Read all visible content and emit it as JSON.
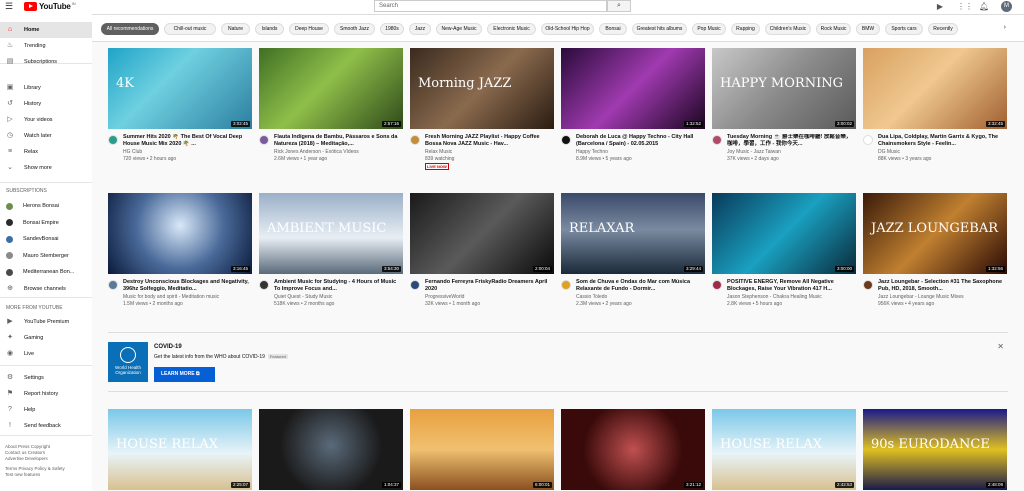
{
  "topbar": {
    "logo_text": "YouTube",
    "logo_sup": "IN",
    "search_placeholder": "Search",
    "avatar_letter": "M"
  },
  "sidebar": {
    "main": [
      {
        "label": "Home",
        "icon": "home-icon",
        "active": true
      },
      {
        "label": "Trending",
        "icon": "fire-icon"
      },
      {
        "label": "Subscriptions",
        "icon": "subscriptions-icon"
      }
    ],
    "library": [
      {
        "label": "Library",
        "icon": "library-icon"
      },
      {
        "label": "History",
        "icon": "history-icon"
      },
      {
        "label": "Your videos",
        "icon": "video-icon"
      },
      {
        "label": "Watch later",
        "icon": "clock-icon"
      },
      {
        "label": "Relax",
        "icon": "playlist-icon"
      },
      {
        "label": "Show more",
        "icon": "chevron-down-icon"
      }
    ],
    "subscriptions_header": "SUBSCRIPTIONS",
    "subscriptions": [
      {
        "label": "Herons Bonsai",
        "color": "#6b8e4e"
      },
      {
        "label": "Bonsai Empire",
        "color": "#2b2b2b",
        "dot": true
      },
      {
        "label": "SandevBonsai",
        "color": "#3a6ea5"
      },
      {
        "label": "Mauro Stemberger",
        "color": "#8a8a8a",
        "dot": true
      },
      {
        "label": "Mediterranean Bon...",
        "color": "#4a4a4a",
        "dot": true
      },
      {
        "label": "Browse channels",
        "color": "",
        "icon": "plus-icon"
      }
    ],
    "more_header": "MORE FROM YOUTUBE",
    "more": [
      {
        "label": "YouTube Premium",
        "icon": "premium-icon"
      },
      {
        "label": "Gaming",
        "icon": "gaming-icon"
      },
      {
        "label": "Live",
        "icon": "live-icon"
      }
    ],
    "settings": [
      {
        "label": "Settings",
        "icon": "gear-icon"
      },
      {
        "label": "Report history",
        "icon": "flag-icon"
      },
      {
        "label": "Help",
        "icon": "help-icon"
      },
      {
        "label": "Send feedback",
        "icon": "feedback-icon"
      }
    ],
    "footer1": "About  Press  Copyright",
    "footer2": "Contact us  Creators",
    "footer3": "Advertise  Developers",
    "footer4": "Terms  Privacy  Policy & Safety",
    "footer5": "Test new features"
  },
  "chips": [
    "All recommendations",
    "Chill-out music",
    "Nature",
    "Islands",
    "Deep House",
    "Smooth Jazz",
    "1980s",
    "Jazz",
    "New-Age Music",
    "Electronic Music",
    "Old-School Hip Hop",
    "Bonsai",
    "Greatest hits albums",
    "Pop Music",
    "Rapping",
    "Children's Music",
    "Rock Music",
    "BMW",
    "Sports cars",
    "Recently"
  ],
  "row1": [
    {
      "title": "Summer Hits 2020 🌴 The Best Of Vocal Deep House Music Mix 2020 🌴 ...",
      "channel": "HG Club",
      "meta": "720 views • 2 hours ago",
      "duration": "3:02:45",
      "thumb": "linear-gradient(135deg,#1fa4c8,#6fd0e0 40%,#2c7fa0)",
      "av": "#2a9d8f",
      "overlay": "4K"
    },
    {
      "title": "Flauta Indígena de Bambu, Pássaros e Sons da Natureza (2018) – Meditação,...",
      "channel": "Rick Jones Anderson - Exótica Vídeos",
      "meta": "2.6M views • 1 year ago",
      "duration": "2:57:16",
      "thumb": "linear-gradient(135deg,#3f6f23,#8fbf4a 45%,#2f4a1a)",
      "av": "#7a5c9e"
    },
    {
      "title": "Fresh Morning JAZZ Playlist - Happy Coffee Bossa Nova JAZZ Music - Hav...",
      "channel": "Relax Music",
      "meta": "839 watching",
      "live": "LIVE NOW",
      "thumb": "linear-gradient(135deg,#3a2a1e,#8a6a4e 50%,#2a1c12)",
      "av": "#c28e3a",
      "overlay": "Morning JAZZ"
    },
    {
      "title": "Deborah de Luca @ Happy Techno - City Hall (Barcelona / Spain) - 02.05.2015",
      "channel": "Happy Techno",
      "meta": "8.9M views • 5 years ago",
      "duration": "1:32:52",
      "thumb": "linear-gradient(135deg,#2a0b3a,#a03ab0 50%,#1a0620)",
      "av": "#111111"
    },
    {
      "title": "Tuesday Morning ☕ 爵士樂在咖啡廳! 放鬆音樂，咖啡，學習，工作 - 我你今天...",
      "channel": "Joy Music - Jazz Taiwan",
      "meta": "37K views • 2 days ago",
      "duration": "3:00:02",
      "thumb": "linear-gradient(135deg,#c8c8c8,#8a8a8a 50%,#5a5a5a)",
      "av": "#b04a6a",
      "overlay": "HAPPY MORNING"
    },
    {
      "title": "Dua Lipa, Coldplay, Martin Garrix & Kygo, The Chainsmokers Style - Feelin...",
      "channel": "DG Music",
      "meta": "88K views • 3 years ago",
      "duration": "3:32:45",
      "thumb": "linear-gradient(135deg,#d8a060,#f0c890 45%,#a06030)",
      "av": "#ffffff"
    }
  ],
  "row2": [
    {
      "title": "Destroy Unconscious Blockages and Negativity, 396hz Solfeggio, Meditatio...",
      "channel": "Music for body and spirit - Meditation music",
      "meta": "1.5M views • 2 months ago",
      "duration": "3:16:45",
      "thumb": "radial-gradient(circle at 50% 40%,#d8e8f8,#4a6a9a 50%,#0a1a3a)",
      "av": "#5a7a9a"
    },
    {
      "title": "Ambient Music for Studying - 4 Hours of Music To Improve Focus and...",
      "channel": "Quiet Quest - Study Music",
      "meta": "518K views • 2 months ago",
      "duration": "3:54:30",
      "thumb": "linear-gradient(180deg,#9ab0c8,#e8eef4 55%,#5a6a7a)",
      "av": "#333333",
      "overlay": "AMBIENT MUSIC"
    },
    {
      "title": "Fernando Ferreyra FriskyRadio Dreamers April 2020",
      "channel": "ProgressiveWorld",
      "meta": "32K views • 1 month ago",
      "duration": "2:00:04",
      "thumb": "linear-gradient(135deg,#1a1a1a,#5a5a5a 50%,#0a0a0a)",
      "av": "#2a4a7a"
    },
    {
      "title": "Som de Chuva e Ondas do Mar com Música Relaxante de Fundo - Dormir...",
      "channel": "Cassio Toledo",
      "meta": "2.3M views • 2 years ago",
      "duration": "3:29:44",
      "thumb": "linear-gradient(180deg,#3a4a6a,#7a8aa0 45%,#1a2a3a)",
      "av": "#e0a020",
      "overlay": "RELAXAR"
    },
    {
      "title": "POSITIVE ENERGY, Remove All Negative Blockages, Raise Your Vibration 417 H...",
      "channel": "Jason Stephenson - Chakra Healing Music",
      "meta": "2.8K views • 5 hours ago",
      "duration": "3:00:00",
      "thumb": "linear-gradient(135deg,#0a3a5a,#1aa0c0 50%,#0a2a3a)",
      "av": "#a02a4a"
    },
    {
      "title": "Jazz Loungebar - Selection #31 The Saxophone Pub, HD, 2018, Smooth...",
      "channel": "Jazz Loungebar - Lounge Music Mixes",
      "meta": "956K views • 4 years ago",
      "duration": "1:32:56",
      "thumb": "linear-gradient(135deg,#3a1a0a,#c08030 50%,#2a0a05)",
      "av": "#6a3a1a",
      "overlay": "JAZZ LOUNGEBAR"
    }
  ],
  "banner": {
    "logo_line1": "World Health",
    "logo_line2": "Organization",
    "title": "COVID-19",
    "desc": "Get the latest info from the WHO about COVID-19",
    "featured": "Featured",
    "button": "LEARN MORE"
  },
  "row3": [
    {
      "duration": "2:25:07",
      "thumb": "linear-gradient(180deg,#7ac8e8,#e8f4f8 55%,#d8c090)",
      "overlay": "HOUSE     RELAX"
    },
    {
      "duration": "1:04:37",
      "thumb": "radial-gradient(circle at 50% 45%,#5a6a7a,#1a1a1a 60%)"
    },
    {
      "duration": "6:00:01",
      "thumb": "linear-gradient(180deg,#e8a040,#f0c070 50%,#8a5020)"
    },
    {
      "duration": "3:21:12",
      "thumb": "radial-gradient(circle at 50% 50%,#c05050,#3a0a0a 60%)"
    },
    {
      "duration": "2:42:53",
      "thumb": "linear-gradient(180deg,#7ac8e8,#e8f4f8 55%,#d8c090)",
      "overlay": "HOUSE     RELAX"
    },
    {
      "duration": "2:48:09",
      "thumb": "linear-gradient(180deg,#1a1a8a,#e0c020 50%,#1a1a4a)",
      "overlay": "90s EURODANCE"
    }
  ]
}
